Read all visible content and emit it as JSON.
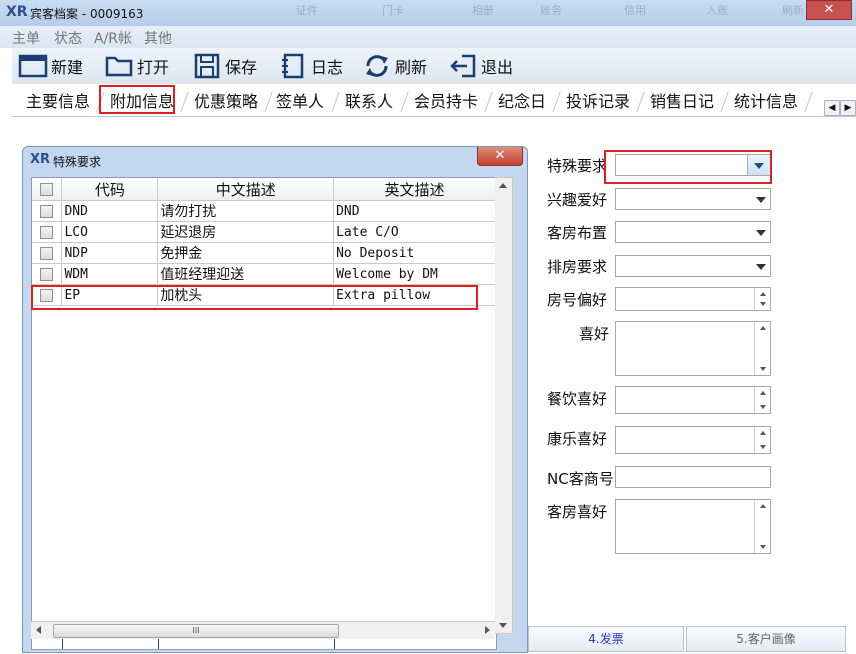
{
  "window": {
    "app_logo": "XR",
    "title": "宾客档案 - 0009163",
    "close_label": "✕",
    "ghost_items": [
      "证件",
      "门卡",
      "相册",
      "账务",
      "信用",
      "入账",
      "刷新"
    ]
  },
  "menu": {
    "items": [
      "主单",
      "状态",
      "A/R帐",
      "其他"
    ]
  },
  "toolbar": {
    "buttons": [
      {
        "label": "新建",
        "icon": "new-window-icon"
      },
      {
        "label": "打开",
        "icon": "open-folder-icon"
      },
      {
        "label": "保存",
        "icon": "save-disk-icon"
      },
      {
        "label": "日志",
        "icon": "log-notebook-icon"
      },
      {
        "label": "刷新",
        "icon": "refresh-icon"
      },
      {
        "label": "退出",
        "icon": "exit-icon"
      }
    ]
  },
  "tabs": {
    "items": [
      "主要信息",
      "附加信息",
      "优惠策略",
      "签单人",
      "联系人",
      "会员持卡",
      "纪念日",
      "投诉记录",
      "销售日记",
      "统计信息"
    ],
    "active_index": 1
  },
  "form": {
    "special_request_label": "特殊要求",
    "hobby_label": "兴趣爱好",
    "room_layout_label": "客房布置",
    "room_assign_label": "排房要求",
    "room_number_pref_label": "房号偏好",
    "likes_label": "喜好",
    "dining_pref_label": "餐饮喜好",
    "recreation_pref_label": "康乐喜好",
    "nc_customer_no_label": "NC客商号",
    "room_pref_label": "客房喜好"
  },
  "transfer_button": "->",
  "bottom_tabs": [
    "4.发票",
    "5.客户画像"
  ],
  "dialog": {
    "logo": "XR",
    "title": "特殊要求",
    "close_label": "✕",
    "columns": [
      "代码",
      "中文描述",
      "英文描述"
    ],
    "rows": [
      {
        "code": "DND",
        "zh": "请勿打扰",
        "en": "DND"
      },
      {
        "code": "LCO",
        "zh": "延迟退房",
        "en": "Late C/O"
      },
      {
        "code": "NDP",
        "zh": "免押金",
        "en": "No Deposit"
      },
      {
        "code": "WDM",
        "zh": "值班经理迎送",
        "en": "Welcome by DM"
      },
      {
        "code": "EP",
        "zh": "加枕头",
        "en": "Extra pillow"
      }
    ],
    "scroll_thumb_grip": "III"
  },
  "accent_colors": {
    "highlight_red": "#e02020",
    "titlebar": "#c9dcf0"
  }
}
